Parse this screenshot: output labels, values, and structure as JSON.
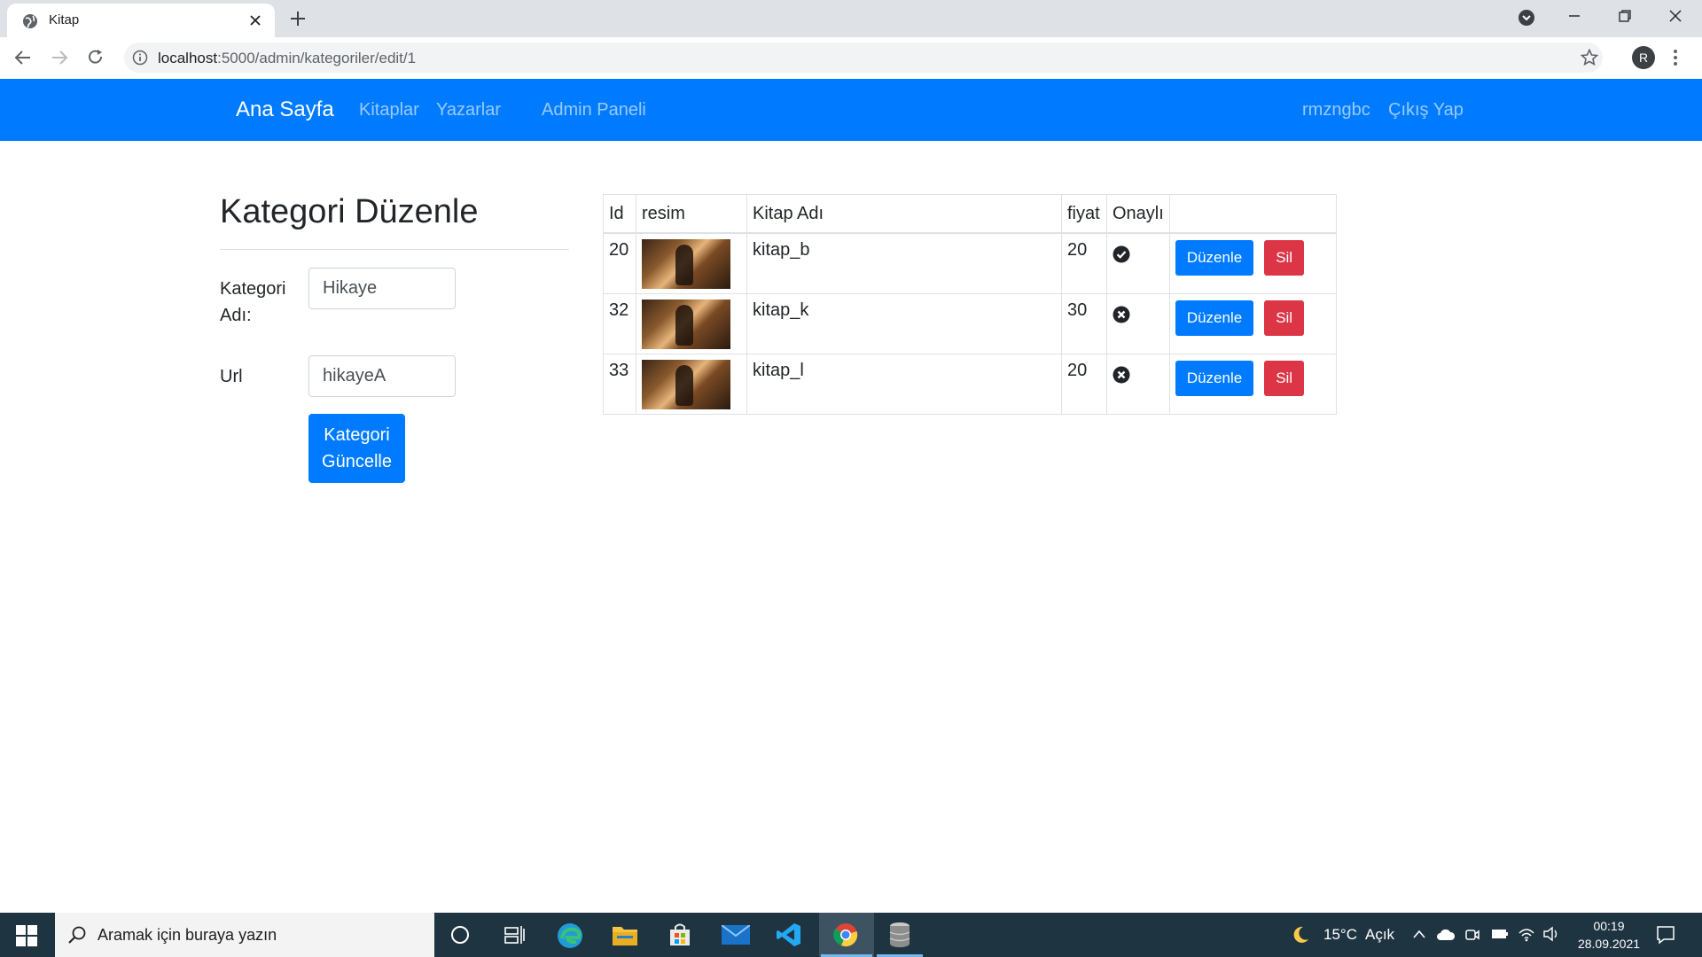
{
  "browser": {
    "tab_title": "Kitap",
    "url_host": "localhost",
    "url_rest": ":5000/admin/kategoriler/edit/1",
    "profile_initial": "R"
  },
  "navbar": {
    "brand": "Ana Sayfa",
    "links": [
      "Kitaplar",
      "Yazarlar",
      "Admin Paneli"
    ],
    "user": "rmzngbc",
    "logout": "Çıkış Yap"
  },
  "form": {
    "title": "Kategori Düzenle",
    "name_label": "Kategori Adı:",
    "name_value": "Hikaye",
    "url_label": "Url",
    "url_value": "hikayeA",
    "submit_label": "Kategori Güncelle"
  },
  "table": {
    "headers": [
      "Id",
      "resim",
      "Kitap Adı",
      "fiyat",
      "Onaylı",
      ""
    ],
    "rows": [
      {
        "id": "20",
        "name": "kitap_b",
        "price": "20",
        "approved": true
      },
      {
        "id": "32",
        "name": "kitap_k",
        "price": "30",
        "approved": false
      },
      {
        "id": "33",
        "name": "kitap_l",
        "price": "20",
        "approved": false
      }
    ],
    "edit_label": "Düzenle",
    "delete_label": "Sil"
  },
  "taskbar": {
    "search_placeholder": "Aramak için buraya yazın",
    "weather": "15°C",
    "weather_text": "Açık",
    "time": "00:19",
    "date": "28.09.2021"
  },
  "colors": {
    "primary": "#007bff",
    "danger": "#dc3545",
    "taskbar": "#1f3441"
  }
}
